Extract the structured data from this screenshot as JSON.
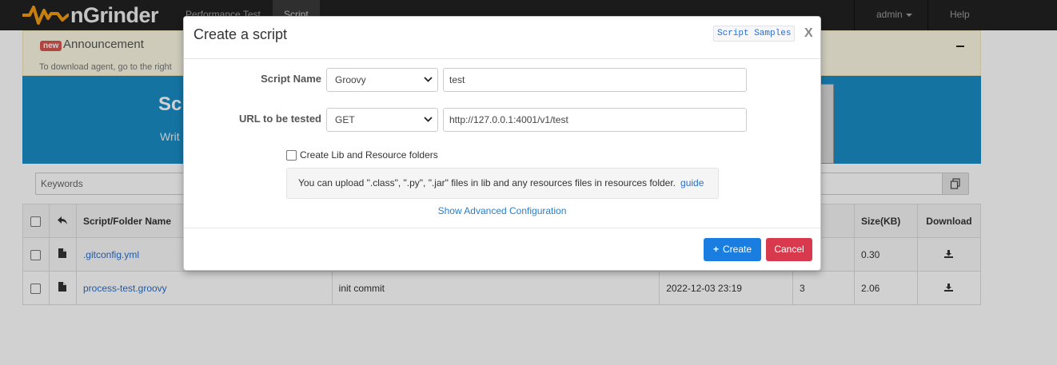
{
  "navbar": {
    "brand": "nGrinder",
    "tabs": [
      {
        "label": "Performance Test"
      },
      {
        "label": "Script"
      }
    ],
    "user": "admin",
    "help": "Help"
  },
  "announcement": {
    "badge": "new",
    "title": "Announcement",
    "text": "To download agent, go to the right"
  },
  "hero": {
    "title": "Scr",
    "subtitle": "Writ"
  },
  "search": {
    "placeholder": "Keywords"
  },
  "table": {
    "headers": {
      "name": "Script/Folder Name",
      "size": "Size(KB)",
      "download": "Download"
    },
    "rows": [
      {
        "name": ".gitconfig.yml",
        "commit": "",
        "date": "",
        "revision": "",
        "size": "0.30"
      },
      {
        "name": "process-test.groovy",
        "commit": "init commit",
        "date": "2022-12-03 23:19",
        "revision": "3",
        "size": "2.06"
      }
    ]
  },
  "modal": {
    "title": "Create a script",
    "samples_label": "Script Samples",
    "close_label": "X",
    "script_name_label": "Script Name",
    "script_type": "Groovy",
    "script_name_value": "test",
    "url_label": "URL to be tested",
    "method": "GET",
    "url_value": "http://127.0.0.1:4001/v1/test",
    "lib_checkbox_label": "Create Lib and Resource folders",
    "info_text": "You can upload \".class\", \".py\", \".jar\" files in lib and any resources files in resources folder.",
    "guide_link": "guide",
    "advanced_link": "Show Advanced Configuration",
    "create_label": "Create",
    "cancel_label": "Cancel"
  },
  "colors": {
    "navbar_bg": "#222222",
    "hero_bg": "#1a8dc6",
    "primary": "#1a7ee0",
    "danger": "#d9394d",
    "link": "#2a6fc9",
    "logo_orange": "#f39c12"
  }
}
